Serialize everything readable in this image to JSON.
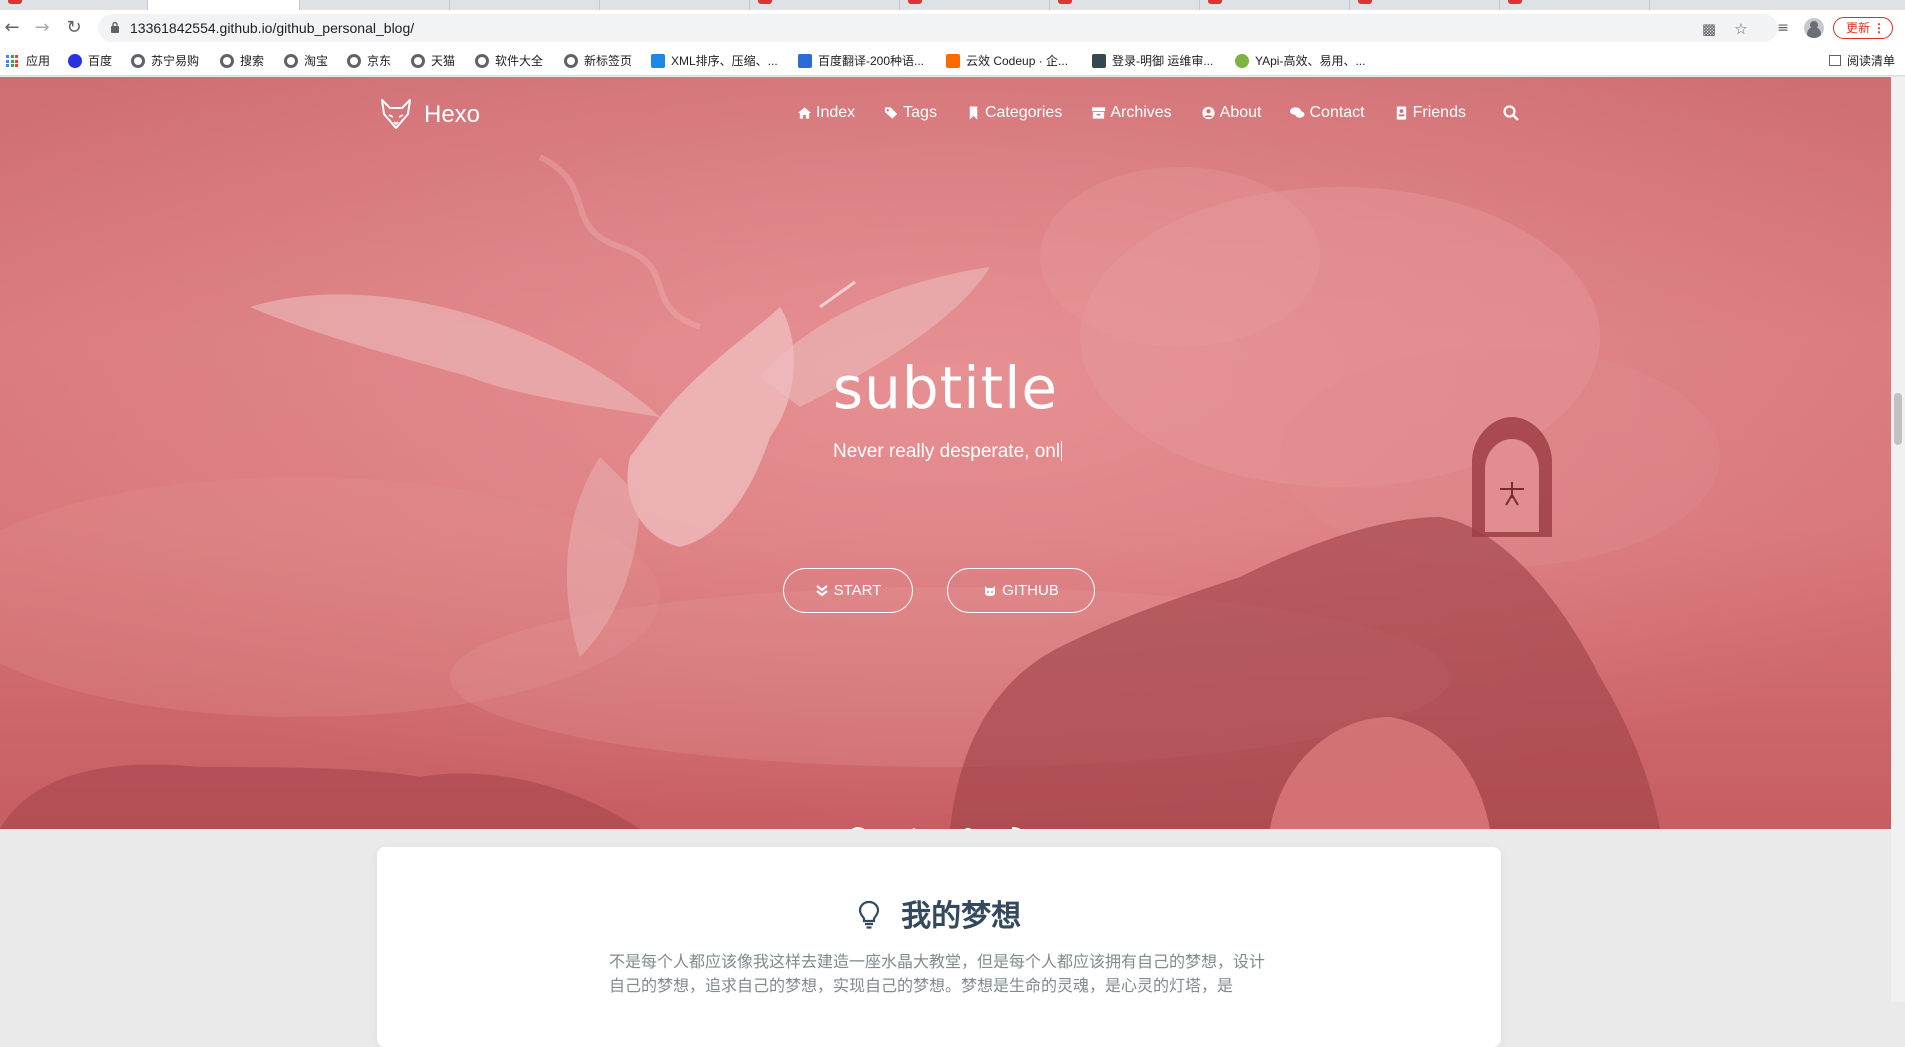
{
  "browser": {
    "url": "13361842554.github.io/github_personal_blog/",
    "update_label": "更新",
    "bookmarks": [
      {
        "label": "应用",
        "icon": "apps-icon"
      },
      {
        "label": "百度",
        "icon": "baidu-icon"
      },
      {
        "label": "苏宁易购",
        "icon": "globe-icon"
      },
      {
        "label": "搜索",
        "icon": "globe-icon"
      },
      {
        "label": "淘宝",
        "icon": "globe-icon"
      },
      {
        "label": "京东",
        "icon": "globe-icon"
      },
      {
        "label": "天猫",
        "icon": "globe-icon"
      },
      {
        "label": "软件大全",
        "icon": "globe-icon"
      },
      {
        "label": "新标签页",
        "icon": "globe-icon"
      },
      {
        "label": "XML排序、压缩、...",
        "icon": "xml-tool-icon"
      },
      {
        "label": "百度翻译-200种语...",
        "icon": "translate-icon"
      },
      {
        "label": "云效 Codeup · 企...",
        "icon": "codeup-icon"
      },
      {
        "label": "登录-明御 运维审...",
        "icon": "shield-icon"
      },
      {
        "label": "YApi-高效、易用、...",
        "icon": "yapi-icon"
      }
    ],
    "reading_list": "阅读清单"
  },
  "site": {
    "brand": "Hexo",
    "nav": [
      {
        "label": "Index",
        "icon": "home-icon"
      },
      {
        "label": "Tags",
        "icon": "tags-icon"
      },
      {
        "label": "Categories",
        "icon": "bookmark-icon"
      },
      {
        "label": "Archives",
        "icon": "archive-icon"
      },
      {
        "label": "About",
        "icon": "user-circle-icon"
      },
      {
        "label": "Contact",
        "icon": "comments-icon"
      },
      {
        "label": "Friends",
        "icon": "address-book-icon"
      }
    ],
    "search_icon": "search-icon"
  },
  "hero": {
    "title": "subtitle",
    "subtitle": "Never really desperate, onl",
    "start_label": "START",
    "github_label": "GITHUB",
    "social_icons": [
      "github-icon",
      "email-icon",
      "qq-icon",
      "rss-icon"
    ],
    "overlay_color": "#d46a6e"
  },
  "card": {
    "title": "我的梦想",
    "text": "不是每个人都应该像我这样去建造一座水晶大教堂，但是每个人都应该拥有自己的梦想，设计自己的梦想，追求自己的梦想，实现自己的梦想。梦想是生命的灵魂，是心灵的灯塔，是"
  }
}
